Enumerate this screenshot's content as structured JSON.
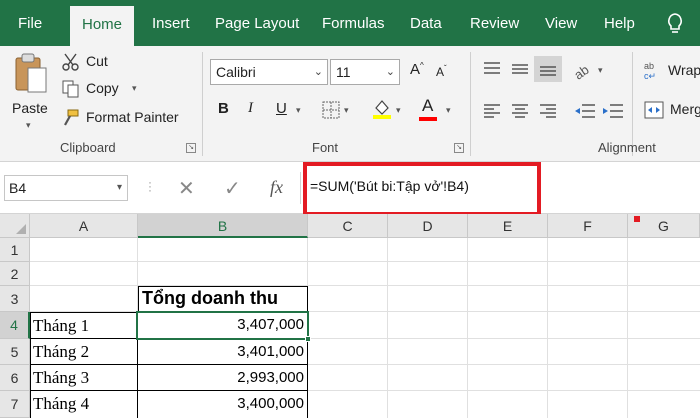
{
  "tabs": [
    {
      "label": "File"
    },
    {
      "label": "Home"
    },
    {
      "label": "Insert"
    },
    {
      "label": "Page Layout"
    },
    {
      "label": "Formulas"
    },
    {
      "label": "Data"
    },
    {
      "label": "Review"
    },
    {
      "label": "View"
    },
    {
      "label": "Help"
    }
  ],
  "clipboard": {
    "paste": "Paste",
    "cut": "Cut",
    "copy": "Copy",
    "format_painter": "Format Painter",
    "label": "Clipboard"
  },
  "font": {
    "name": "Calibri",
    "size": "11",
    "label": "Font",
    "bold": "B",
    "italic": "I",
    "underline": "U",
    "color_letter": "A"
  },
  "alignment": {
    "wrap": "Wrap",
    "merge": "Merg",
    "label": "Alignment"
  },
  "formula_bar": {
    "name_box": "B4",
    "formula": "=SUM('Bút bi:Tập vở'!B4)",
    "fx": "fx"
  },
  "columns": [
    "A",
    "B",
    "C",
    "D",
    "E",
    "F",
    "G"
  ],
  "rows": [
    "1",
    "2",
    "3",
    "4",
    "5",
    "6",
    "7"
  ],
  "sheet": {
    "header_b3": "Tổng doanh thu",
    "data": [
      {
        "month": "Tháng 1",
        "value": "3,407,000"
      },
      {
        "month": "Tháng 2",
        "value": "3,401,000"
      },
      {
        "month": "Tháng 3",
        "value": "2,993,000"
      },
      {
        "month": "Tháng 4",
        "value": "3,400,000"
      }
    ]
  },
  "colors": {
    "excel_green": "#217346",
    "highlight_red": "#e31b23",
    "fill_yellow": "#ffff00",
    "font_red": "#ff0000"
  }
}
